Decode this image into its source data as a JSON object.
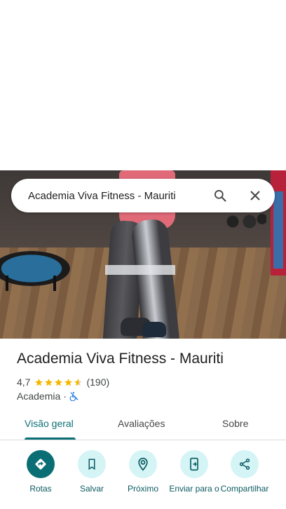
{
  "search": {
    "query": "Academia Viva Fitness - Mauriti"
  },
  "place": {
    "title": "Academia Viva Fitness - Mauriti",
    "rating": "4,7",
    "rating_fraction": 0.94,
    "review_count": "(190)",
    "category": "Academia",
    "separator": "·"
  },
  "tabs": [
    {
      "label": "Visão geral",
      "active": true
    },
    {
      "label": "Avaliações",
      "active": false
    },
    {
      "label": "Sobre",
      "active": false
    }
  ],
  "actions": [
    {
      "label": "Rotas",
      "icon": "directions-icon"
    },
    {
      "label": "Salvar",
      "icon": "bookmark-icon"
    },
    {
      "label": "Próximo",
      "icon": "nearby-icon"
    },
    {
      "label": "Enviar para o",
      "icon": "send-to-phone-icon"
    },
    {
      "label": "Compartilhar",
      "icon": "share-icon"
    }
  ],
  "colors": {
    "accent": "#0b6e75",
    "accent_light": "#d4f4f6",
    "star": "#f6b700",
    "wheelchair_icon": "#1a73e8"
  }
}
